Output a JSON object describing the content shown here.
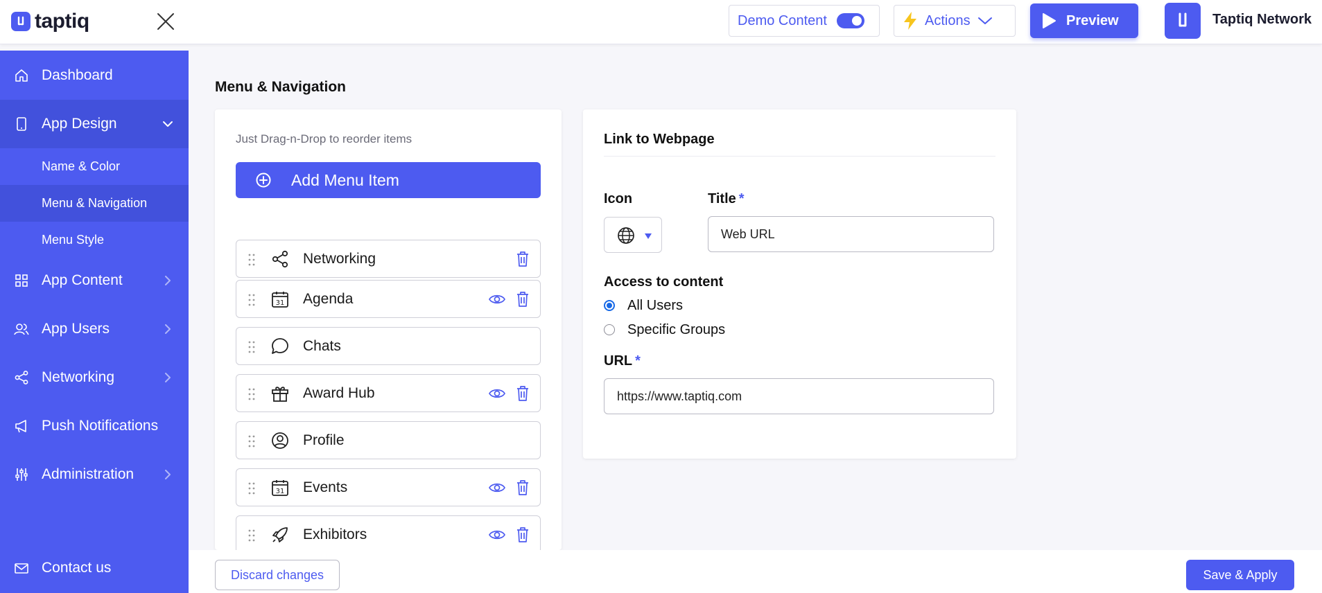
{
  "header": {
    "logo_text": "taptiq",
    "demo_label": "Demo Content",
    "demo_enabled": true,
    "actions_label": "Actions",
    "preview_label": "Preview",
    "org_name": "Taptiq Network",
    "accent_color": "#4d5bf0"
  },
  "sidebar": {
    "items": [
      {
        "label": "Dashboard",
        "icon": "home-icon"
      },
      {
        "label": "App Design",
        "icon": "phone-icon"
      },
      {
        "label": "App Content",
        "icon": "grid-icon"
      },
      {
        "label": "App Users",
        "icon": "users-icon"
      },
      {
        "label": "Networking",
        "icon": "share-icon"
      },
      {
        "label": "Push Notifications",
        "icon": "megaphone-icon"
      },
      {
        "label": "Administration",
        "icon": "sliders-icon"
      }
    ],
    "subitems": [
      {
        "label": "Name & Color"
      },
      {
        "label": "Menu & Navigation"
      },
      {
        "label": "Menu Style"
      }
    ],
    "contact_label": "Contact us"
  },
  "main": {
    "title": "Menu & Navigation",
    "hint": "Just Drag-n-Drop to reorder items",
    "add_label": "Add Menu Item",
    "menu_items": [
      {
        "label": "Networking",
        "icon": "share-icon",
        "visibility": false,
        "delete": true
      },
      {
        "label": "Agenda",
        "icon": "calendar-icon",
        "visibility": true,
        "delete": true
      },
      {
        "label": "Chats",
        "icon": "chat-bubble-icon",
        "visibility": false,
        "delete": false
      },
      {
        "label": "Award Hub",
        "icon": "gift-icon",
        "visibility": true,
        "delete": true
      },
      {
        "label": "Profile",
        "icon": "user-circle-icon",
        "visibility": false,
        "delete": false
      },
      {
        "label": "Events",
        "icon": "calendar-icon",
        "visibility": true,
        "delete": true
      },
      {
        "label": "Exhibitors",
        "icon": "rocket-icon",
        "visibility": true,
        "delete": true
      }
    ]
  },
  "link": {
    "title": "Link to Webpage",
    "icon_label": "Icon",
    "selected_icon": "globe-icon",
    "title_label": "Title",
    "title_value": "Web URL",
    "access_label": "Access to content",
    "options": [
      {
        "label": "All Users",
        "checked": true
      },
      {
        "label": "Specific Groups",
        "checked": false
      }
    ],
    "url_label": "URL",
    "url_value": "https://www.taptiq.com",
    "required_mark": "*"
  },
  "footer": {
    "discard_label": "Discard changes",
    "save_label": "Save & Apply"
  }
}
